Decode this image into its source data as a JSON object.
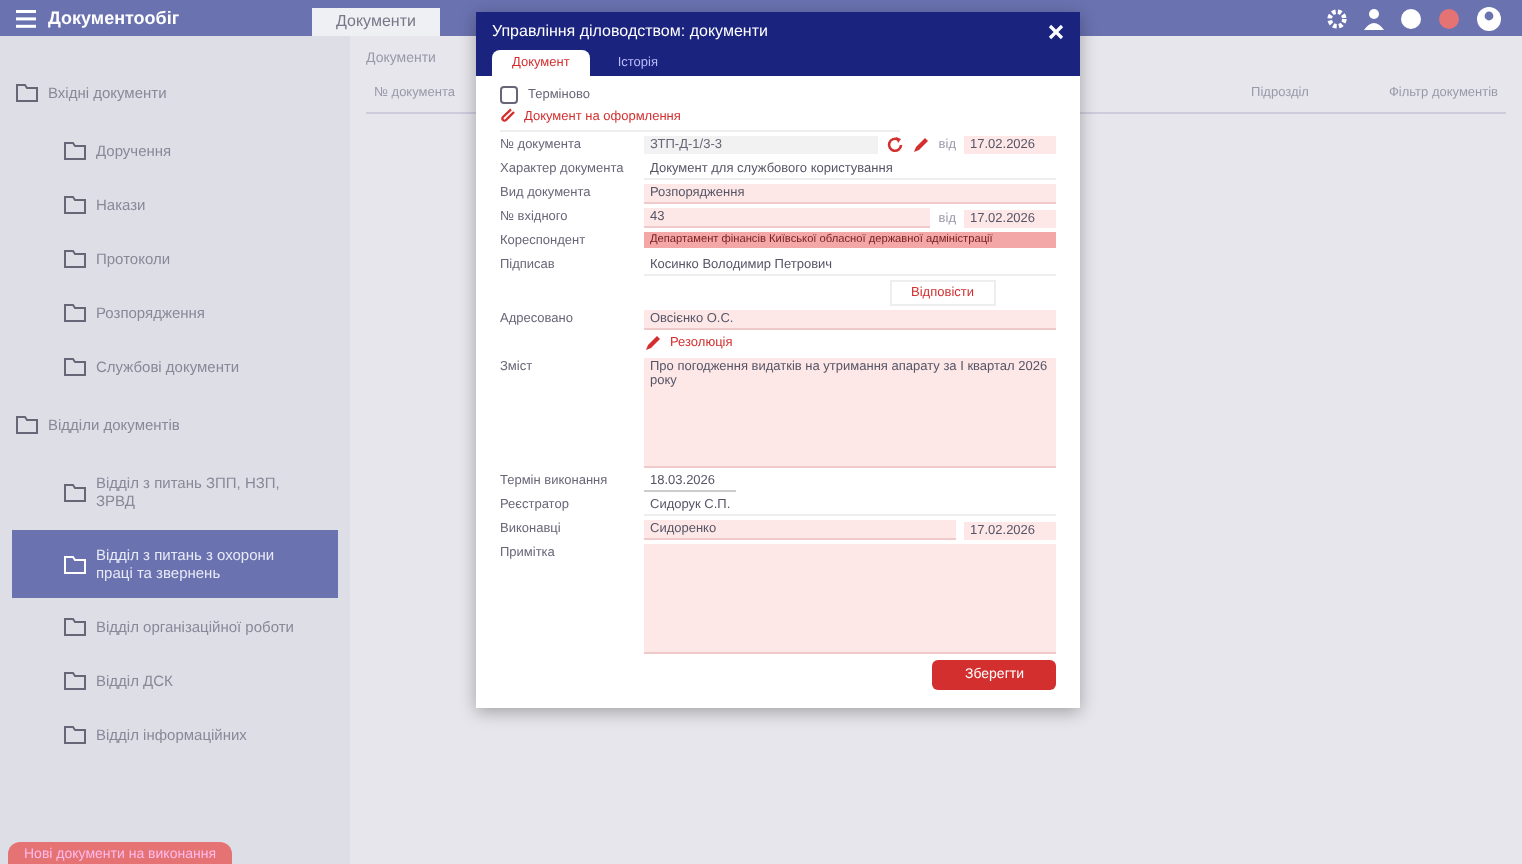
{
  "app": {
    "logo": "Документообіг",
    "tabs": [
      {
        "label": "Документи",
        "selected": true
      }
    ]
  },
  "toolbar": {
    "breadcrumb": "Документи",
    "column_1": "№ документа",
    "column_2": "Підрозділ",
    "filter": "Фільтр документів"
  },
  "sidebar": {
    "groups": [
      {
        "label": "Вхідні документи",
        "items": [
          {
            "label": "Доручення",
            "selected": false
          },
          {
            "label": "Накази",
            "selected": false
          },
          {
            "label": "Протоколи",
            "selected": false
          },
          {
            "label": "Розпорядження",
            "selected": false
          },
          {
            "label": "Службові документи",
            "selected": false
          }
        ]
      },
      {
        "label": "Відділи документів",
        "items": [
          {
            "label": "Відділ з питань ЗПП, НЗП, ЗРВД",
            "selected": false
          },
          {
            "label": "Відділ з питань з охорони праці та звернень",
            "selected": true
          },
          {
            "label": "Відділ організаційної роботи",
            "selected": false
          },
          {
            "label": "Відділ ДСК",
            "selected": false
          },
          {
            "label": "Відділ інформаційних",
            "selected": false
          }
        ]
      }
    ],
    "bottom_button": "Нові документи на виконання"
  },
  "dialog": {
    "title": "Управління діловодством: документи",
    "tabs": [
      {
        "label": "Документ",
        "selected": true
      },
      {
        "label": "Історія",
        "selected": false
      }
    ],
    "urgent": {
      "label": "Терміново",
      "checked": false
    },
    "link": "Документ на оформлення",
    "fields": [
      {
        "kind": "numbered",
        "label": "№ документа",
        "value": "ЗТП-Д-1/3-3",
        "date_label": "від",
        "date": "17.02.2026"
      },
      {
        "kind": "plain",
        "label": "Характер документа",
        "value": "Документ для службового користування"
      },
      {
        "kind": "text",
        "label": "Вид документа",
        "value": "Розпорядження"
      },
      {
        "kind": "dated",
        "label": "№ вхідного",
        "value": "43",
        "date_label": "від",
        "date": "17.02.2026"
      },
      {
        "kind": "error",
        "label": "Кореспондент",
        "value": "Департамент фінансів Київської обласної державної адміністрації"
      },
      {
        "kind": "plain",
        "label": "Підписав",
        "value": "Косинко Володимир Петрович"
      },
      {
        "kind": "reply",
        "label": "Відповісти"
      },
      {
        "kind": "text",
        "label": "Адресовано",
        "value": "Овсієнко О.С."
      },
      {
        "kind": "resolution",
        "label": "Резолюція"
      },
      {
        "kind": "area",
        "label": "Зміст",
        "value": "Про погодження видатків на утримання апарату за І квартал 2026 року"
      },
      {
        "kind": "short",
        "label": "Термін виконання",
        "value": "18.03.2026"
      },
      {
        "kind": "plain",
        "label": "Реєстратор",
        "value": "Сидорук С.П."
      },
      {
        "kind": "dated",
        "label": "Виконавці",
        "value": "Сидоренко",
        "date": "17.02.2026"
      },
      {
        "kind": "area",
        "label": "Примітка"
      }
    ],
    "save": "Зберегти"
  }
}
